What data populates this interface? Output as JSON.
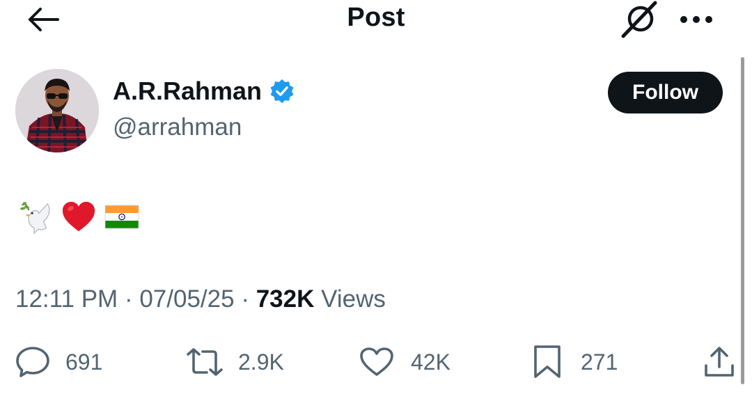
{
  "header": {
    "title": "Post"
  },
  "author": {
    "display_name": "A.R.Rahman",
    "handle": "@arrahman",
    "verified": true,
    "follow_label": "Follow"
  },
  "post": {
    "emojis": [
      "dove",
      "red-heart",
      "flag-india"
    ]
  },
  "meta": {
    "time": "12:11 PM",
    "date": "07/05/25",
    "separator": "·",
    "views_count": "732K",
    "views_label": "Views"
  },
  "actions": {
    "replies": "691",
    "reposts": "2.9K",
    "likes": "42K",
    "bookmarks": "271"
  },
  "colors": {
    "text_primary": "#0f1419",
    "text_secondary": "#536471",
    "verified_blue": "#1d9bf0",
    "follow_bg": "#0f1419"
  }
}
